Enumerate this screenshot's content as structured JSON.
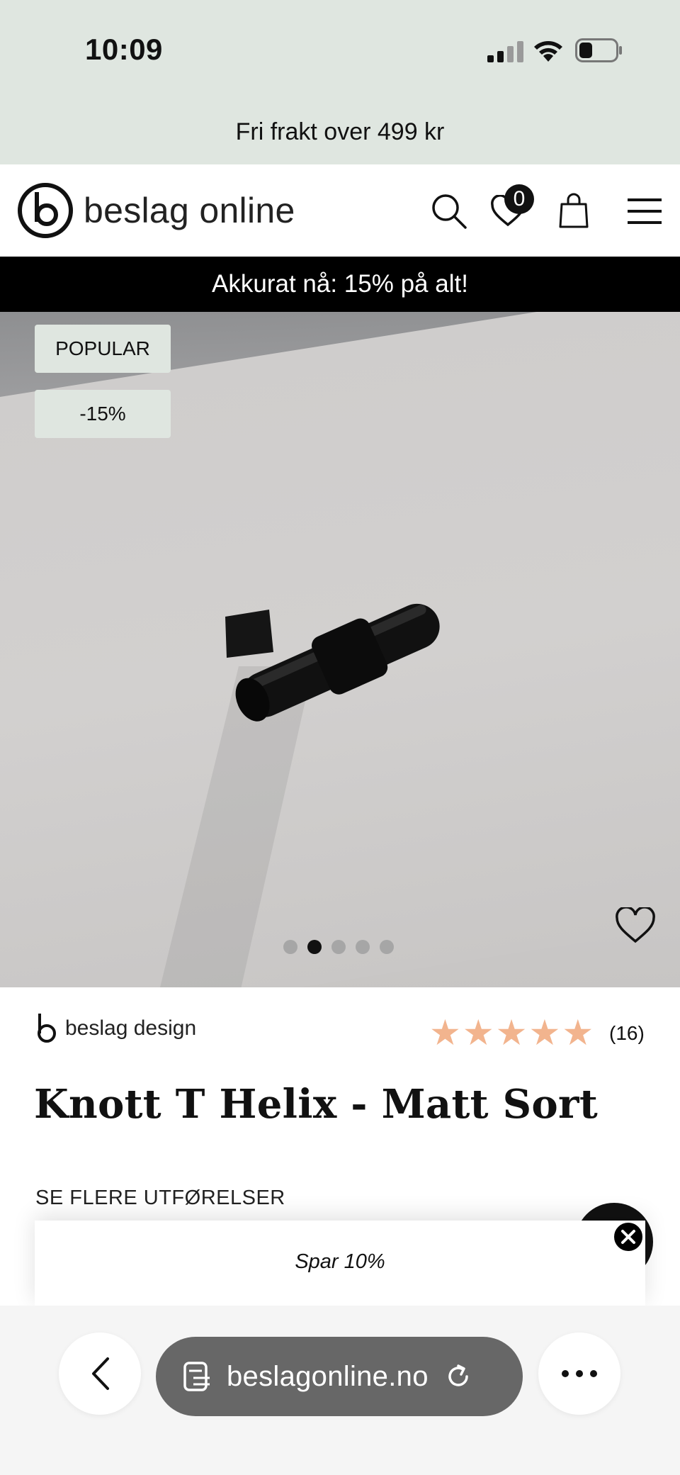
{
  "status_bar": {
    "time": "10:09"
  },
  "promo": {
    "text": "Fri frakt over 499 kr"
  },
  "header": {
    "logo_text": "beslag online",
    "wishlist_count": "0"
  },
  "sale_banner": {
    "text": "Akkurat nå: 15% på alt!"
  },
  "hero": {
    "tags": [
      "POPULAR",
      "-15%"
    ],
    "slide_count": 5,
    "active_slide": 2
  },
  "product": {
    "brand": "beslag design",
    "rating": 5,
    "star_color": "#f2b48e",
    "review_count": "(16)",
    "title": "Knott T Helix - Matt Sort",
    "variants_label": "SE FLERE UTFØRELSER"
  },
  "popup": {
    "text": "Spar 10%"
  },
  "browser": {
    "url": "beslagonline.no"
  },
  "colors": {
    "mint": "#dfe6e0",
    "sale_bg": "#000000",
    "urlbar": "#676767"
  },
  "icons": [
    "signal-icon",
    "wifi-icon",
    "battery-icon",
    "search-icon",
    "heart-icon",
    "bag-icon",
    "menu-icon",
    "back-icon",
    "tabs-icon",
    "reload-icon",
    "more-icon",
    "close-icon"
  ]
}
